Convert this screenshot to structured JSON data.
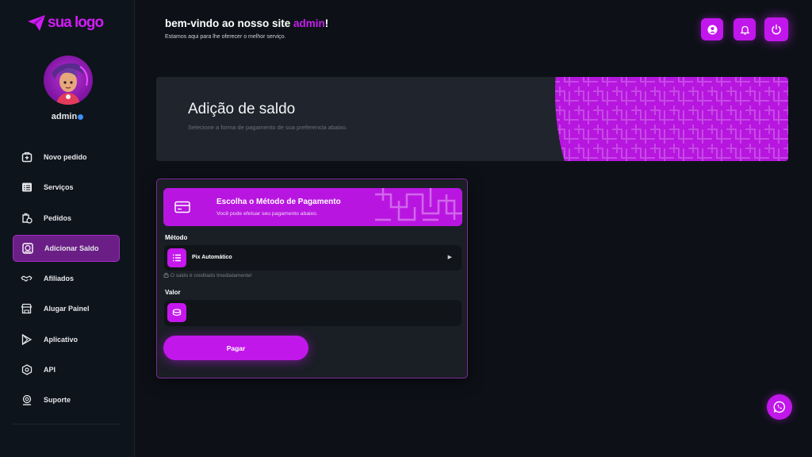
{
  "brand": {
    "logo_text": "sua logo",
    "accent": "#c117ea"
  },
  "user": {
    "name": "admin"
  },
  "sidebar": {
    "items": [
      {
        "label": "Novo pedido",
        "icon": "cart-plus-icon",
        "active": false
      },
      {
        "label": "Serviços",
        "icon": "list-icon",
        "active": false
      },
      {
        "label": "Pedidos",
        "icon": "orders-icon",
        "active": false
      },
      {
        "label": "Adicionar Saldo",
        "icon": "money-bag-icon",
        "active": true
      },
      {
        "label": "Afiliados",
        "icon": "handshake-icon",
        "active": false
      },
      {
        "label": "Alugar Painel",
        "icon": "store-icon",
        "active": false
      },
      {
        "label": "Aplicativo",
        "icon": "play-store-icon",
        "active": false
      },
      {
        "label": "API",
        "icon": "api-icon",
        "active": false
      },
      {
        "label": "Suporte",
        "icon": "headset-icon",
        "active": false
      }
    ]
  },
  "header": {
    "welcome_prefix": "bem-vindo ao nosso site ",
    "welcome_user": "admin",
    "welcome_suffix": "!",
    "subtitle": "Estamos aqui para lhe oferecer o melhor serviço."
  },
  "banner": {
    "title": "Adição de saldo",
    "subtitle": "Selecione a forma de pagamento de sua preferencia abaixo."
  },
  "payment": {
    "title": "Escolha o Método de Pagamento",
    "subtitle": "Você pode efetuar seu pagamento abaixo.",
    "method_label": "Método",
    "method_value": "Pix Automático",
    "method_hint": "O saldo é creditado Imediatamente!",
    "amount_label": "Valor",
    "amount_value": "",
    "pay_button": "Pagar"
  }
}
